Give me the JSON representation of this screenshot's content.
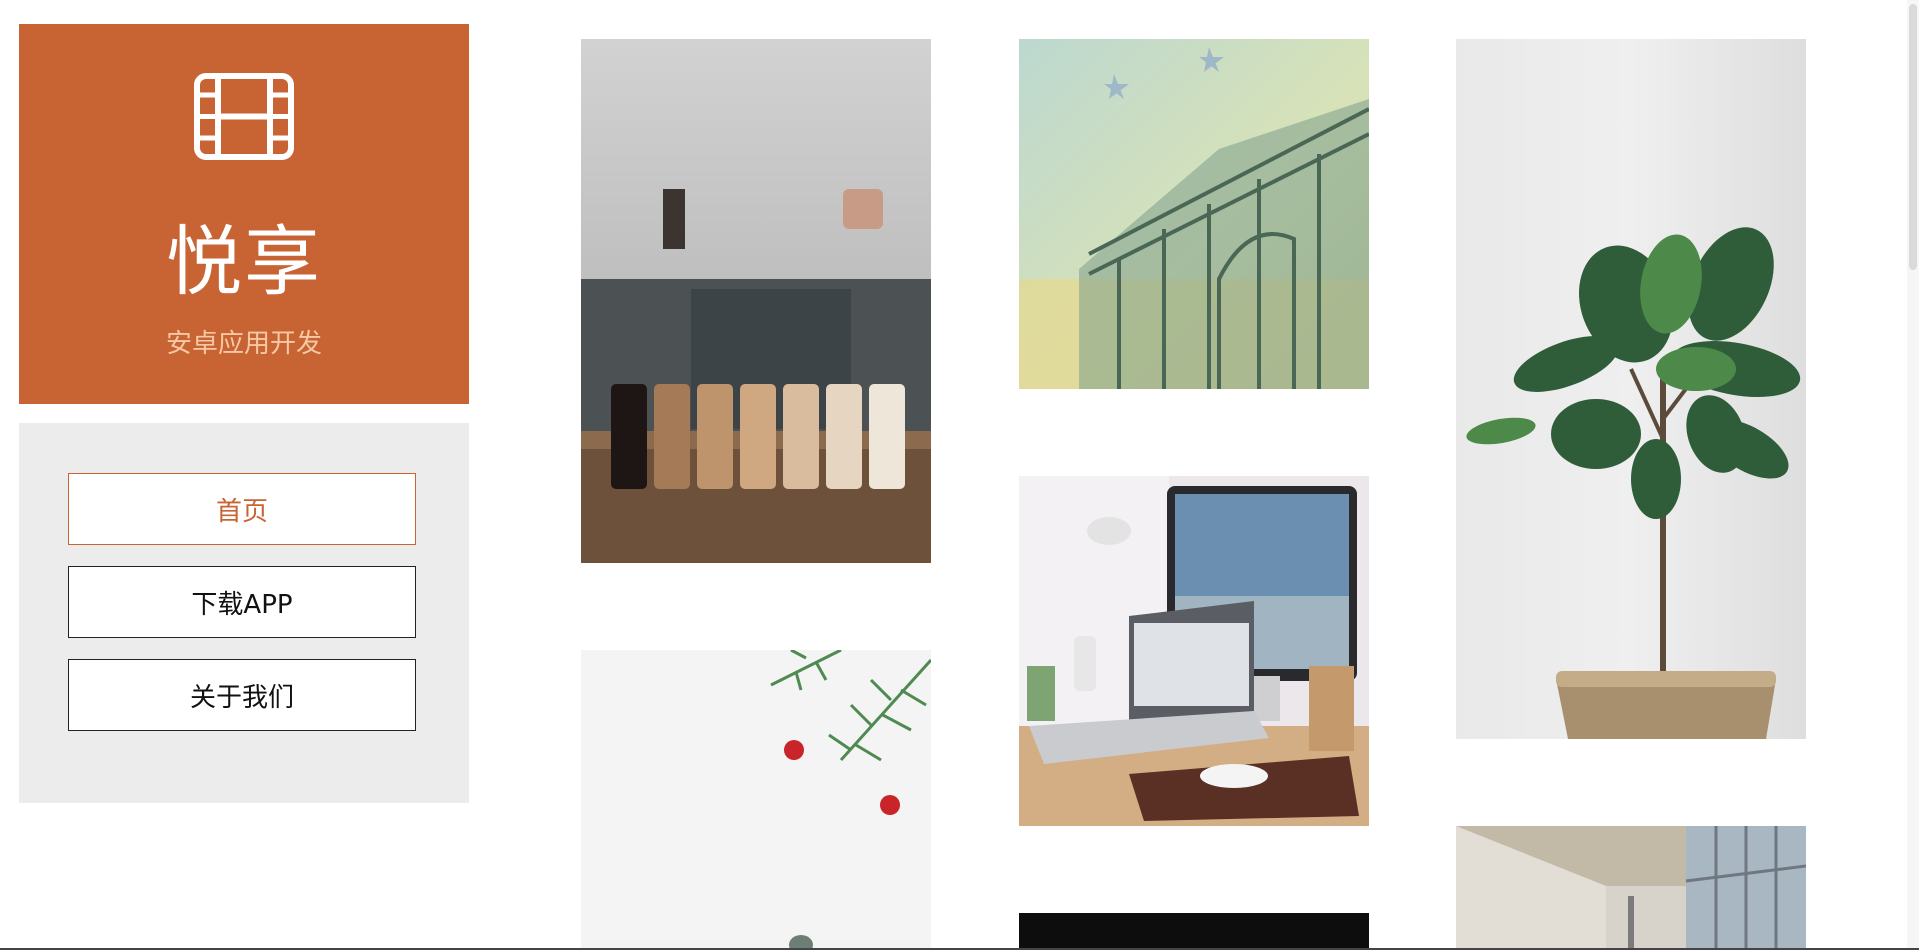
{
  "brand": {
    "icon": "film-icon",
    "title": "悦享",
    "subtitle": "安卓应用开发",
    "color": "#c86434"
  },
  "nav": {
    "items": [
      {
        "label": "首页",
        "active": true
      },
      {
        "label": "下载APP",
        "active": false
      },
      {
        "label": "关于我们",
        "active": false
      }
    ]
  },
  "gallery": {
    "tiles": [
      {
        "subject": "coffee-jars-photo"
      },
      {
        "subject": "christmas-pine-berries-photo"
      },
      {
        "subject": "banknote-arch-photo"
      },
      {
        "subject": "desk-laptop-monitor-photo"
      },
      {
        "subject": "dark-photo"
      },
      {
        "subject": "fiddle-leaf-plant-photo"
      },
      {
        "subject": "office-corridor-photo"
      }
    ]
  }
}
